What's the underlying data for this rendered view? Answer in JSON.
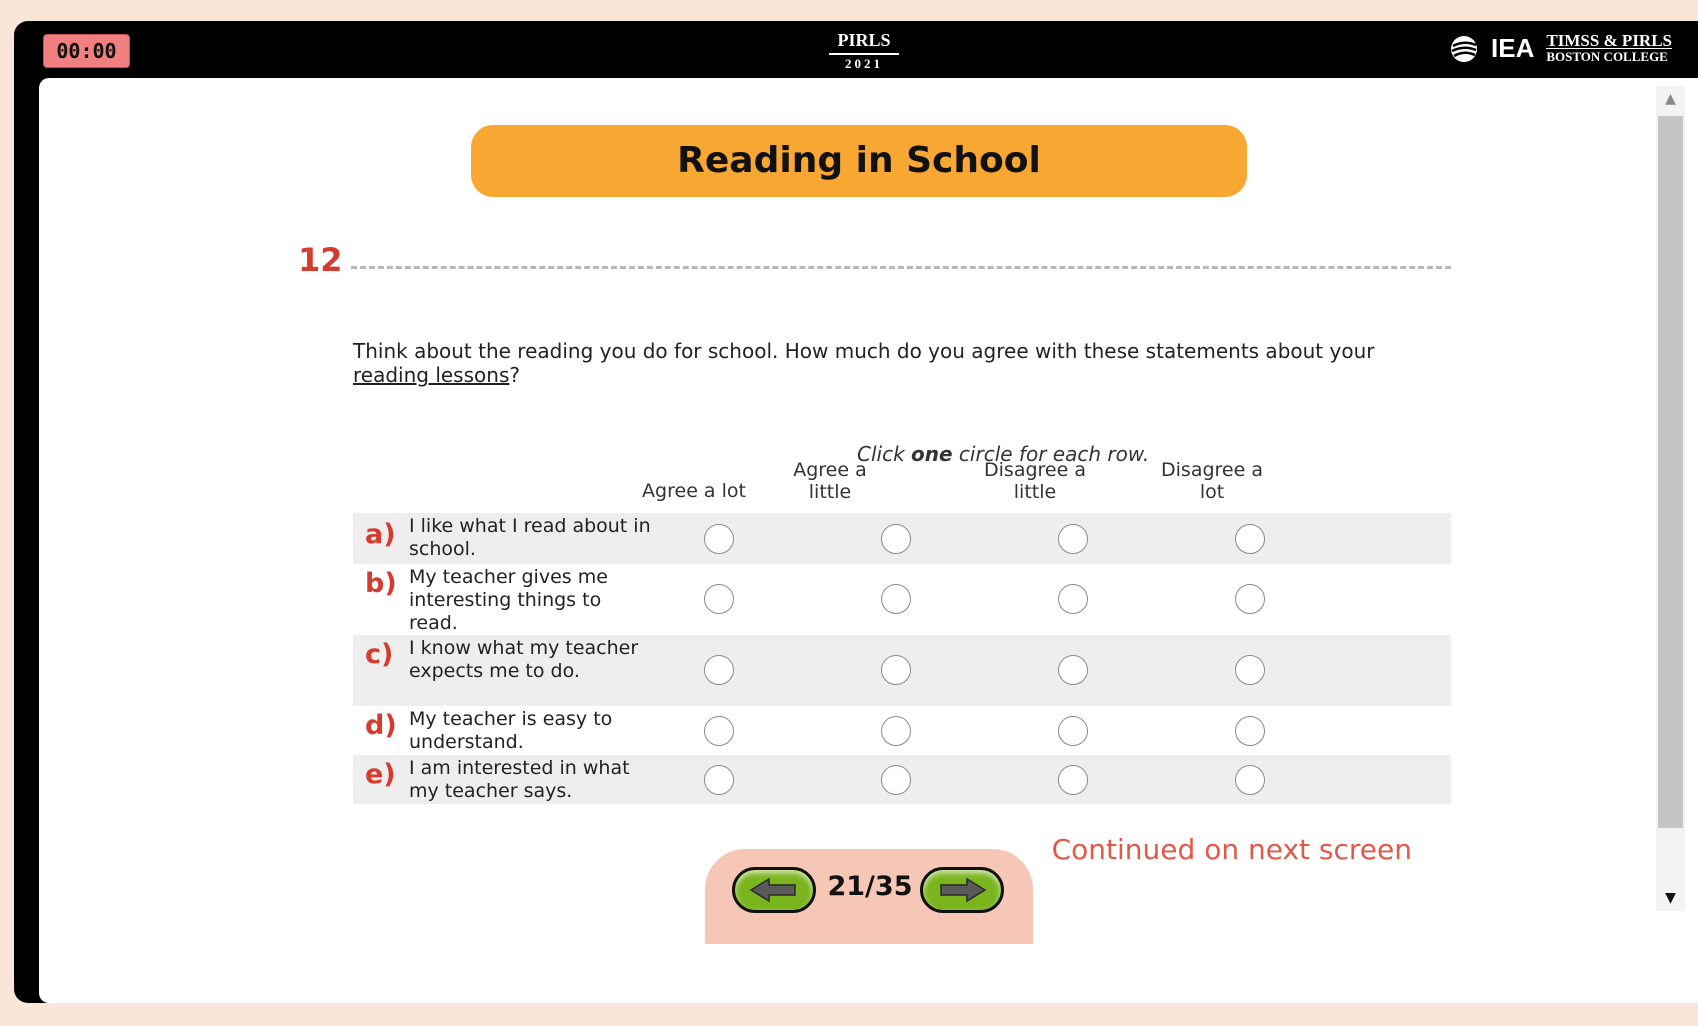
{
  "timer": "00:00",
  "header": {
    "pirls": "PIRLS",
    "year": "2021",
    "iea": "IEA",
    "timss_pirls": "TIMSS & PIRLS",
    "college": "BOSTON COLLEGE"
  },
  "page": {
    "title": "Reading in School",
    "question_number": "12",
    "question_text": "Think about the reading you do for school. How much do you agree with these statements about your",
    "question_underlined": "reading lessons",
    "question_end": "?",
    "instruction_pre": "Click",
    "instruction_bold": "one",
    "instruction_post": "circle for each row.",
    "continued": "Continued on next screen"
  },
  "columns": [
    "Agree a lot",
    "Agree a little",
    "Disagree a little",
    "Disagree a lot"
  ],
  "rows": [
    {
      "letter": "a)",
      "text": "I like what I read about in school."
    },
    {
      "letter": "b)",
      "text": "My teacher gives me interesting things to read."
    },
    {
      "letter": "c)",
      "text": "I know what my teacher expects me to do."
    },
    {
      "letter": "d)",
      "text": "My teacher is easy to understand."
    },
    {
      "letter": "e)",
      "text": "I am interested in what my teacher says."
    }
  ],
  "nav": {
    "page": "21/35",
    "prev_icon": "arrow-left-icon",
    "next_icon": "arrow-right-icon"
  },
  "colors": {
    "accent": "#f8a733",
    "label_red": "#d63b2f",
    "nav_green": "#7ab51d",
    "nav_panel": "#f6c7b7"
  }
}
